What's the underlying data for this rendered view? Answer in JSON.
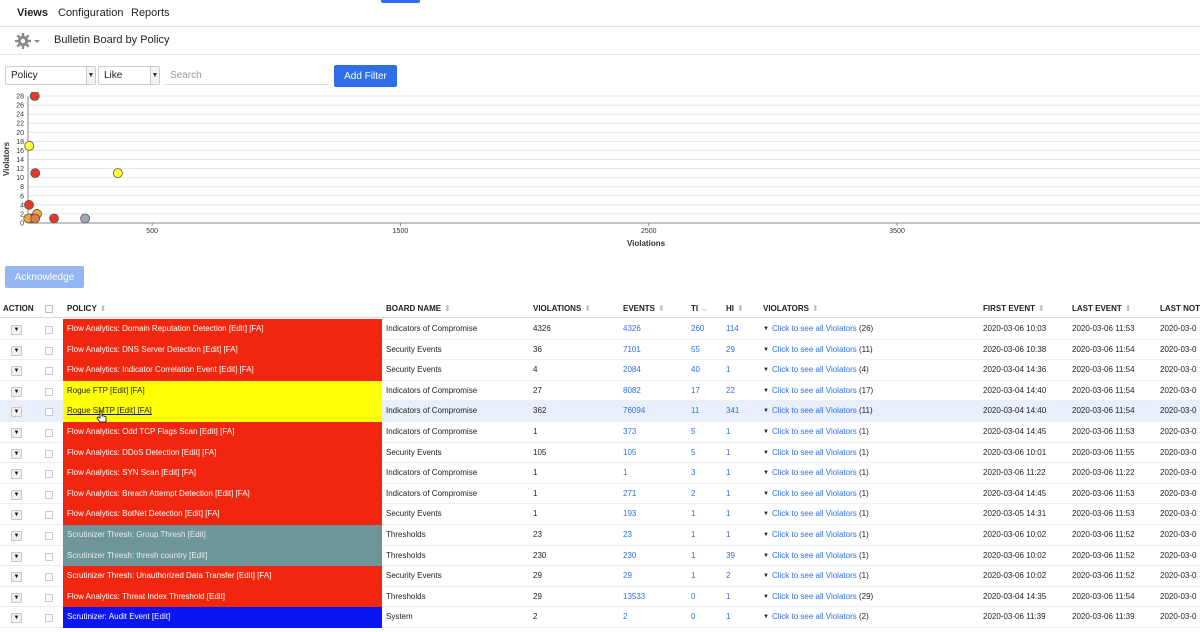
{
  "nav": {
    "tabs": [
      "Views",
      "Configuration",
      "Reports"
    ]
  },
  "toolbar": {
    "title": "Bulletin Board by Policy"
  },
  "filter": {
    "field_value": "Policy",
    "operator_value": "Like",
    "search_placeholder": "Search",
    "add_filter_label": "Add Filter"
  },
  "colors": {
    "accent": "#2e6fe8",
    "red": "#f0260e",
    "yellow": "#ffff06",
    "gray": "#6e9597",
    "blue": "#0a17f2"
  },
  "chart_data": {
    "type": "scatter",
    "xlabel": "Violations",
    "ylabel": "Violators",
    "xlim": [
      0,
      4720
    ],
    "ylim": [
      0,
      28
    ],
    "xticks": [
      "500",
      "1500",
      "2500",
      "3500"
    ],
    "yticks": [
      "0",
      "2",
      "4",
      "6",
      "8",
      "10",
      "12",
      "14",
      "16",
      "18",
      "20",
      "22",
      "24",
      "26",
      "28"
    ],
    "grid": true,
    "points": [
      {
        "x": 27,
        "y": 28,
        "color": "#e53a2a"
      },
      {
        "x": 5,
        "y": 17,
        "color": "#ffff33"
      },
      {
        "x": 29,
        "y": 11,
        "color": "#e53a2a"
      },
      {
        "x": 362,
        "y": 11,
        "color": "#ffff33"
      },
      {
        "x": 4,
        "y": 4,
        "color": "#e53a2a"
      },
      {
        "x": 36,
        "y": 2,
        "color": "#ffa533"
      },
      {
        "x": 23,
        "y": 1,
        "color": "#f2a13a"
      },
      {
        "x": 10,
        "y": 1,
        "color": "#e53a2a"
      },
      {
        "x": 1,
        "y": 1,
        "color": "#f2a13a"
      },
      {
        "x": 105,
        "y": 1,
        "color": "#e53a2a"
      },
      {
        "x": 230,
        "y": 1,
        "color": "#9aaab3"
      },
      {
        "x": 29,
        "y": 1,
        "color": "#e07a4a"
      }
    ]
  },
  "acknowledge_label": "Acknowledge",
  "table": {
    "columns": [
      "ACTION",
      "POLICY",
      "BOARD NAME",
      "VIOLATIONS",
      "EVENTS",
      "TI",
      "HI",
      "VIOLATORS",
      "FIRST EVENT",
      "LAST EVENT",
      "LAST NOTI"
    ],
    "action_glyph": "▼",
    "rows": [
      {
        "policy": "Flow Analytics: Domain Reputation Detection  [Edit]  [FA]",
        "color": "red",
        "board": "Indicators of Compromise",
        "violations": "4326",
        "events": "4326",
        "ti": "260",
        "hi": "114",
        "violators_link": "Click to see all Violators",
        "violators_count": "(26)",
        "first": "2020-03-06 10:03",
        "last": "2020-03-06 11:53",
        "last_noti": "2020-03-0"
      },
      {
        "policy": "Flow Analytics: DNS Server Detection  [Edit]  [FA]",
        "color": "red",
        "board": "Security Events",
        "violations": "36",
        "events": "7101",
        "ti": "55",
        "hi": "29",
        "violators_link": "Click to see all Violators",
        "violators_count": "(11)",
        "first": "2020-03-06 10:38",
        "last": "2020-03-06 11:54",
        "last_noti": "2020-03-0"
      },
      {
        "policy": "Flow Analytics: Indicator Correlation Event  [Edit]  [FA]",
        "color": "red",
        "board": "Security Events",
        "violations": "4",
        "events": "2084",
        "ti": "40",
        "hi": "1",
        "violators_link": "Click to see all Violators",
        "violators_count": "(4)",
        "first": "2020-03-04 14:36",
        "last": "2020-03-06 11:54",
        "last_noti": "2020-03-0"
      },
      {
        "policy": "Rogue FTP  [Edit]  [FA]",
        "color": "yellow",
        "board": "Indicators of Compromise",
        "violations": "27",
        "events": "8082",
        "ti": "17",
        "hi": "22",
        "violators_link": "Click to see all Violators",
        "violators_count": "(17)",
        "first": "2020-03-04 14:40",
        "last": "2020-03-06 11:54",
        "last_noti": "2020-03-0"
      },
      {
        "policy": "Rogue SMTP  [Edit]  [FA]",
        "color": "yellow",
        "board": "Indicators of Compromise",
        "violations": "362",
        "events": "76094",
        "ti": "11",
        "hi": "341",
        "violators_link": "Click to see all Violators",
        "violators_count": "(11)",
        "first": "2020-03-04 14:40",
        "last": "2020-03-06 11:54",
        "last_noti": "2020-03-0"
      },
      {
        "policy": "Flow Analytics: Odd TCP Flags Scan  [Edit]  [FA]",
        "color": "red",
        "board": "Indicators of Compromise",
        "violations": "1",
        "events": "373",
        "ti": "5",
        "hi": "1",
        "violators_link": "Click to see all Violators",
        "violators_count": "(1)",
        "first": "2020-03-04 14:45",
        "last": "2020-03-06 11:53",
        "last_noti": "2020-03-0"
      },
      {
        "policy": "Flow Analytics: DDoS Detection  [Edit]  [FA]",
        "color": "red",
        "board": "Security Events",
        "violations": "105",
        "events": "105",
        "ti": "5",
        "hi": "1",
        "violators_link": "Click to see all Violators",
        "violators_count": "(1)",
        "first": "2020-03-06 10:01",
        "last": "2020-03-06 11:55",
        "last_noti": "2020-03-0"
      },
      {
        "policy": "Flow Analytics: SYN Scan  [Edit]  [FA]",
        "color": "red",
        "board": "Indicators of Compromise",
        "violations": "1",
        "events": "1",
        "ti": "3",
        "hi": "1",
        "violators_link": "Click to see all Violators",
        "violators_count": "(1)",
        "first": "2020-03-06 11:22",
        "last": "2020-03-06 11:22",
        "last_noti": "2020-03-0"
      },
      {
        "policy": "Flow Analytics: Breach Attempt Detection  [Edit]  [FA]",
        "color": "red",
        "board": "Indicators of Compromise",
        "violations": "1",
        "events": "271",
        "ti": "2",
        "hi": "1",
        "violators_link": "Click to see all Violators",
        "violators_count": "(1)",
        "first": "2020-03-04 14:45",
        "last": "2020-03-06 11:53",
        "last_noti": "2020-03-0"
      },
      {
        "policy": "Flow Analytics: BotNet Detection  [Edit]  [FA]",
        "color": "red",
        "board": "Security Events",
        "violations": "1",
        "events": "193",
        "ti": "1",
        "hi": "1",
        "violators_link": "Click to see all Violators",
        "violators_count": "(1)",
        "first": "2020-03-05 14:31",
        "last": "2020-03-06 11:53",
        "last_noti": "2020-03-0"
      },
      {
        "policy": "Scrutinizer Thresh: Group Thresh  [Edit]",
        "color": "gray",
        "board": "Thresholds",
        "violations": "23",
        "events": "23",
        "ti": "1",
        "hi": "1",
        "violators_link": "Click to see all Violators",
        "violators_count": "(1)",
        "first": "2020-03-06 10:02",
        "last": "2020-03-06 11:52",
        "last_noti": "2020-03-0"
      },
      {
        "policy": "Scrutinizer Thresh: thresh country  [Edit]",
        "color": "gray",
        "board": "Thresholds",
        "violations": "230",
        "events": "230",
        "ti": "1",
        "hi": "39",
        "violators_link": "Click to see all Violators",
        "violators_count": "(1)",
        "first": "2020-03-06 10:02",
        "last": "2020-03-06 11:52",
        "last_noti": "2020-03-0"
      },
      {
        "policy": "Scrutinizer Thresh: Unauthorized Data Transfer  [Edit]  [FA]",
        "color": "red",
        "board": "Security Events",
        "violations": "29",
        "events": "29",
        "ti": "1",
        "hi": "2",
        "violators_link": "Click to see all Violators",
        "violators_count": "(1)",
        "first": "2020-03-06 10:02",
        "last": "2020-03-06 11:52",
        "last_noti": "2020-03-0"
      },
      {
        "policy": "Flow Analytics: Threat Index Threshold  [Edit]",
        "color": "red",
        "board": "Thresholds",
        "violations": "29",
        "events": "13533",
        "ti": "0",
        "hi": "1",
        "violators_link": "Click to see all Violators",
        "violators_count": "(29)",
        "first": "2020-03-04 14:35",
        "last": "2020-03-06 11:54",
        "last_noti": "2020-03-0"
      },
      {
        "policy": "Scrutinizer: Audit Event  [Edit]",
        "color": "blue",
        "board": "System",
        "violations": "2",
        "events": "2",
        "ti": "0",
        "hi": "1",
        "violators_link": "Click to see all Violators",
        "violators_count": "(2)",
        "first": "2020-03-06 11:39",
        "last": "2020-03-06 11:39",
        "last_noti": "2020-03-0"
      }
    ]
  }
}
